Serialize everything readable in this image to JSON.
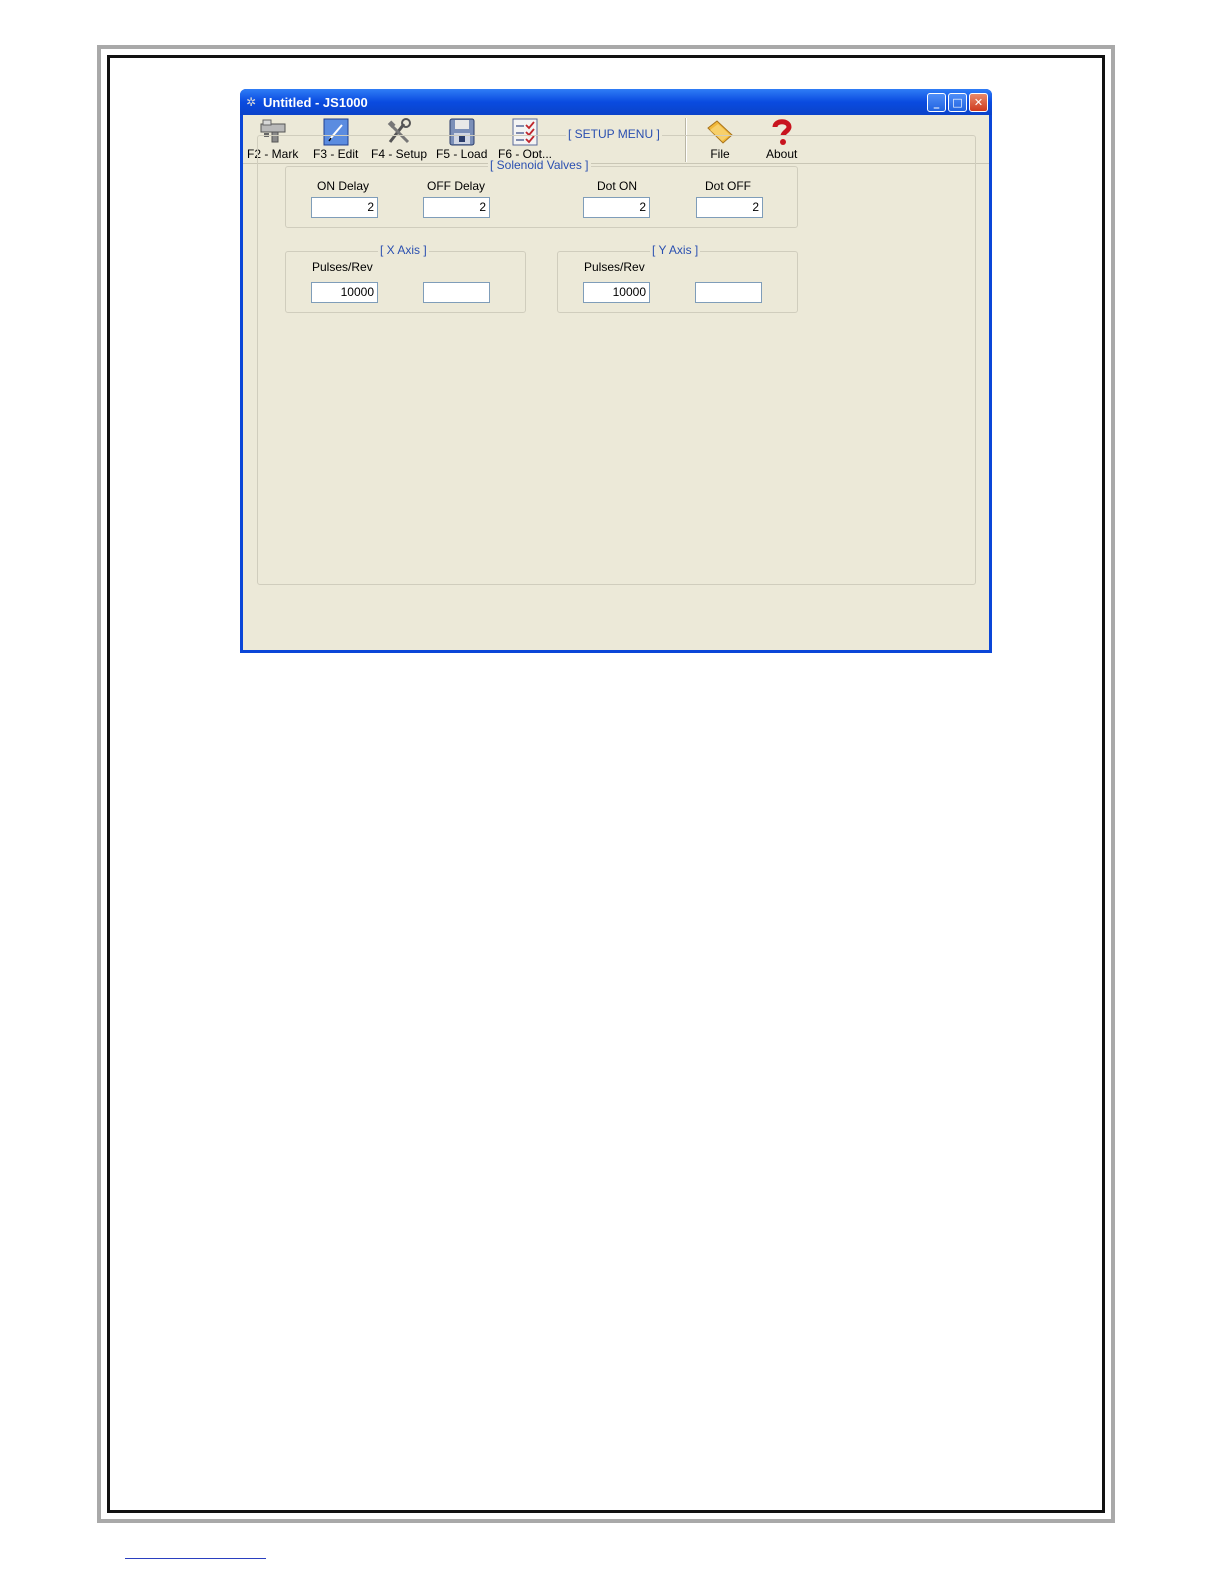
{
  "window": {
    "title": "Untitled - JS1000",
    "controls": {
      "minimize": "_",
      "maximize": "□",
      "close": "✕"
    }
  },
  "toolbar": {
    "items": [
      {
        "label": "F2 - Mark",
        "icon": "marker-machine-icon"
      },
      {
        "label": "F3 - Edit",
        "icon": "pencil-edit-icon"
      },
      {
        "label": "F4 - Setup",
        "icon": "tools-icon"
      },
      {
        "label": "F5 - Load",
        "icon": "floppy-disk-icon"
      },
      {
        "label": "F6 - Opt...",
        "icon": "checklist-icon"
      },
      {
        "label": "File",
        "icon": "folder-icon"
      },
      {
        "label": "About",
        "icon": "help-icon"
      }
    ]
  },
  "setup_menu": {
    "title": "[ SETUP MENU ]",
    "solenoid_valves": {
      "title": "[ Solenoid Valves ]",
      "on_delay": {
        "label": "ON Delay",
        "value": "2"
      },
      "off_delay": {
        "label": "OFF Delay",
        "value": "2"
      },
      "dot_on": {
        "label": "Dot ON",
        "value": "2"
      },
      "dot_off": {
        "label": "Dot OFF",
        "value": "2"
      }
    },
    "x_axis": {
      "title": "[ X Axis ]",
      "pulses_label": "Pulses/Rev",
      "pulses_value": "10000",
      "second_value": ""
    },
    "y_axis": {
      "title": "[ Y Axis ]",
      "pulses_label": "Pulses/Rev",
      "pulses_value": "10000",
      "second_value": ""
    }
  }
}
